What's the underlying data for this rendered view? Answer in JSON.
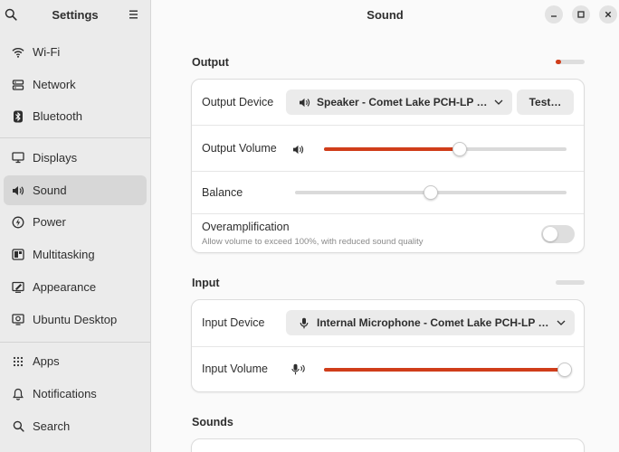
{
  "sidebar": {
    "title": "Settings",
    "items": [
      {
        "label": "Wi-Fi",
        "icon": "wifi-icon"
      },
      {
        "label": "Network",
        "icon": "network-icon"
      },
      {
        "label": "Bluetooth",
        "icon": "bluetooth-icon"
      },
      {
        "label": "Displays",
        "icon": "display-icon"
      },
      {
        "label": "Sound",
        "icon": "sound-icon"
      },
      {
        "label": "Power",
        "icon": "power-icon"
      },
      {
        "label": "Multitasking",
        "icon": "multitasking-icon"
      },
      {
        "label": "Appearance",
        "icon": "appearance-icon"
      },
      {
        "label": "Ubuntu Desktop",
        "icon": "ubuntu-desktop-icon"
      },
      {
        "label": "Apps",
        "icon": "apps-icon"
      },
      {
        "label": "Notifications",
        "icon": "bell-icon"
      },
      {
        "label": "Search",
        "icon": "search-icon"
      }
    ],
    "active": "Sound"
  },
  "header": {
    "title": "Sound"
  },
  "output": {
    "section_title": "Output",
    "level_fraction": 0.2,
    "device_label": "Output Device",
    "device_value": "Speaker - Comet Lake PCH-LP cAVS",
    "test_label": "Test…",
    "volume_label": "Output Volume",
    "volume_fraction": 0.56,
    "balance_label": "Balance",
    "balance_fraction": 0.5,
    "overamp_label": "Overamplification",
    "overamp_desc": "Allow volume to exceed 100%, with reduced sound quality",
    "overamp_enabled": false
  },
  "input": {
    "section_title": "Input",
    "level_fraction": 0.0,
    "device_label": "Input Device",
    "device_value": "Internal Microphone - Comet Lake PCH-LP cAVS",
    "volume_label": "Input Volume",
    "volume_fraction": 1.0
  },
  "sounds": {
    "section_title": "Sounds"
  },
  "colors": {
    "accent": "#d03d1a",
    "sidebar_bg": "#ebebeb",
    "content_bg": "#fafafa"
  }
}
